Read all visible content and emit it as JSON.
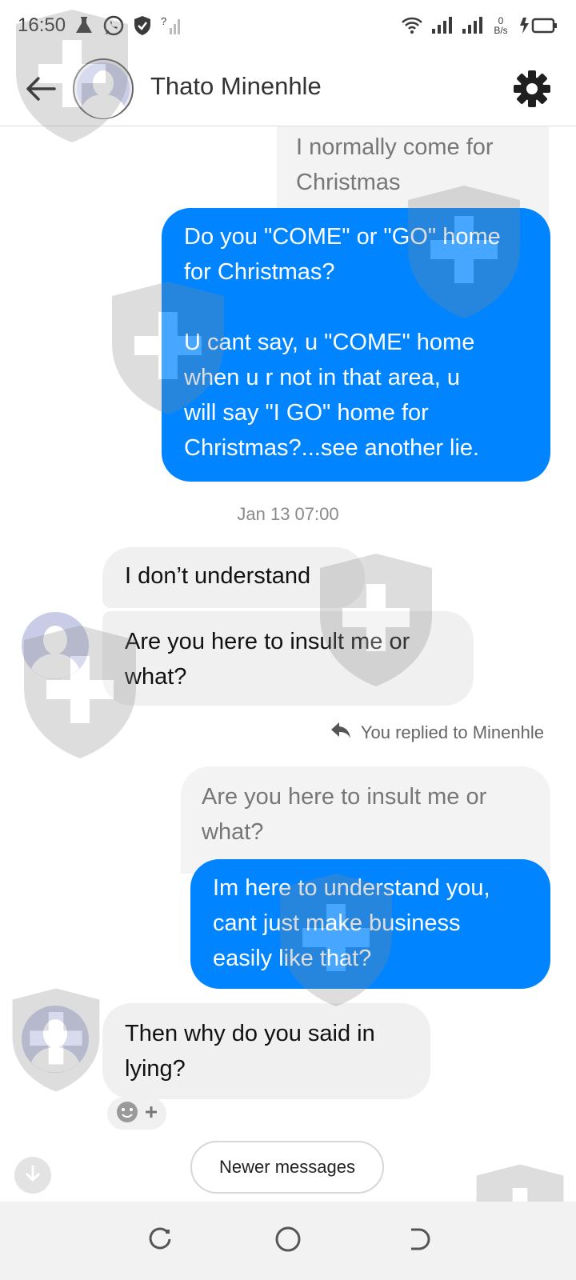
{
  "status_bar": {
    "time": "16:50",
    "network_speed": "0 B/s"
  },
  "header": {
    "contact_name": "Thato Minenhle"
  },
  "messages": {
    "quoted_top": "I normally come for\nChristmas",
    "out_1": "Do you \"COME\" or \"GO\" home\nfor Christmas?\n\nU cant say, u \"COME\" home\nwhen u r not in that area, u\nwill say \"I GO\" home for\nChristmas?...see another lie.",
    "timestamp": "Jan 13 07:00",
    "in_1": "I don’t understand",
    "in_2": "Are you here to insult me or\nwhat?",
    "reply_note": "You replied to Minenhle",
    "quoted_reply": "Are you here to insult me or\nwhat?",
    "out_2": "Im here to understand you,\ncant just make business\neasily like that?",
    "in_3": "Then why do you said in\nlying?"
  },
  "controls": {
    "newer_messages": "Newer messages"
  },
  "colors": {
    "outgoing_bubble": "#0084ff",
    "incoming_bubble": "#f0f0f0"
  },
  "icons": [
    "back-arrow-icon",
    "settings-gear-icon",
    "reply-icon",
    "emoji-icon",
    "scroll-down-icon"
  ]
}
